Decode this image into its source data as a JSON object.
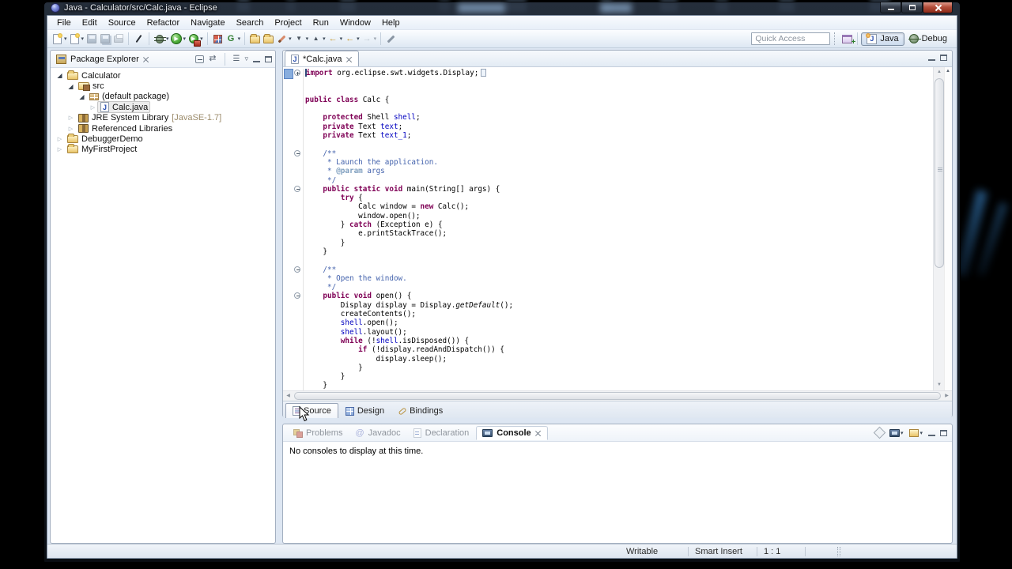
{
  "window": {
    "title": "Java - Calculator/src/Calc.java - Eclipse"
  },
  "menu": {
    "items": [
      "File",
      "Edit",
      "Source",
      "Refactor",
      "Navigate",
      "Search",
      "Project",
      "Run",
      "Window",
      "Help"
    ]
  },
  "toolbar": {
    "quick_access": {
      "placeholder": "Quick Access"
    },
    "perspectives": [
      {
        "label": "Java",
        "active": true
      },
      {
        "label": "Debug",
        "active": false
      }
    ]
  },
  "package_explorer": {
    "title": "Package Explorer",
    "tree": [
      {
        "label": "Calculator",
        "level": 0,
        "state": "expanded",
        "icon": "project"
      },
      {
        "label": "src",
        "level": 1,
        "state": "expanded",
        "icon": "srcfolder"
      },
      {
        "label": "(default package)",
        "level": 2,
        "state": "expanded",
        "icon": "package"
      },
      {
        "label": "Calc.java",
        "level": 3,
        "state": "collapsed",
        "icon": "javafile",
        "selected": true
      },
      {
        "label": "JRE System Library",
        "suffix": "[JavaSE-1.7]",
        "level": 1,
        "state": "collapsed",
        "icon": "library"
      },
      {
        "label": "Referenced Libraries",
        "level": 1,
        "state": "collapsed",
        "icon": "library"
      },
      {
        "label": "DebuggerDemo",
        "level": 0,
        "state": "collapsed",
        "icon": "project"
      },
      {
        "label": "MyFirstProject",
        "level": 0,
        "state": "collapsed",
        "icon": "project"
      }
    ]
  },
  "editor": {
    "tab_label": "*Calc.java",
    "pages": [
      {
        "label": "Source",
        "active": true
      },
      {
        "label": "Design",
        "active": false
      },
      {
        "label": "Bindings",
        "active": false
      }
    ],
    "code": [
      {
        "fold": "+",
        "caret": true,
        "current": true,
        "t": [
          [
            "k",
            "import"
          ],
          [
            "p",
            " org.eclipse.swt.widgets.Display;"
          ],
          [
            "b",
            ""
          ]
        ]
      },
      {
        "t": []
      },
      {
        "t": []
      },
      {
        "t": [
          [
            "k",
            "public"
          ],
          [
            "p",
            " "
          ],
          [
            "k",
            "class"
          ],
          [
            "p",
            " Calc {"
          ]
        ]
      },
      {
        "t": []
      },
      {
        "t": [
          [
            "p",
            "    "
          ],
          [
            "k",
            "protected"
          ],
          [
            "p",
            " Shell "
          ],
          [
            "f",
            "shell"
          ],
          [
            "p",
            ";"
          ]
        ]
      },
      {
        "t": [
          [
            "p",
            "    "
          ],
          [
            "k",
            "private"
          ],
          [
            "p",
            " Text "
          ],
          [
            "f",
            "text"
          ],
          [
            "p",
            ";"
          ]
        ]
      },
      {
        "t": [
          [
            "p",
            "    "
          ],
          [
            "k",
            "private"
          ],
          [
            "p",
            " Text "
          ],
          [
            "f",
            "text_1"
          ],
          [
            "p",
            ";"
          ]
        ]
      },
      {
        "t": []
      },
      {
        "fold": "-",
        "t": [
          [
            "c",
            "    /**"
          ]
        ]
      },
      {
        "t": [
          [
            "c",
            "     * Launch the application."
          ]
        ]
      },
      {
        "t": [
          [
            "c",
            "     * "
          ],
          [
            "t",
            "@param"
          ],
          [
            "c",
            " args"
          ]
        ]
      },
      {
        "t": [
          [
            "c",
            "     */"
          ]
        ]
      },
      {
        "fold": "-",
        "t": [
          [
            "p",
            "    "
          ],
          [
            "k",
            "public"
          ],
          [
            "p",
            " "
          ],
          [
            "k",
            "static"
          ],
          [
            "p",
            " "
          ],
          [
            "k",
            "void"
          ],
          [
            "p",
            " main(String[] args) {"
          ]
        ]
      },
      {
        "t": [
          [
            "p",
            "        "
          ],
          [
            "k",
            "try"
          ],
          [
            "p",
            " {"
          ]
        ]
      },
      {
        "t": [
          [
            "p",
            "            Calc window = "
          ],
          [
            "k",
            "new"
          ],
          [
            "p",
            " Calc();"
          ]
        ]
      },
      {
        "t": [
          [
            "p",
            "            window.open();"
          ]
        ]
      },
      {
        "t": [
          [
            "p",
            "        } "
          ],
          [
            "k",
            "catch"
          ],
          [
            "p",
            " (Exception e) {"
          ]
        ]
      },
      {
        "t": [
          [
            "p",
            "            e.printStackTrace();"
          ]
        ]
      },
      {
        "t": [
          [
            "p",
            "        }"
          ]
        ]
      },
      {
        "t": [
          [
            "p",
            "    }"
          ]
        ]
      },
      {
        "t": []
      },
      {
        "fold": "-",
        "t": [
          [
            "c",
            "    /**"
          ]
        ]
      },
      {
        "t": [
          [
            "c",
            "     * Open the window."
          ]
        ]
      },
      {
        "t": [
          [
            "c",
            "     */"
          ]
        ]
      },
      {
        "fold": "-",
        "t": [
          [
            "p",
            "    "
          ],
          [
            "k",
            "public"
          ],
          [
            "p",
            " "
          ],
          [
            "k",
            "void"
          ],
          [
            "p",
            " open() {"
          ]
        ]
      },
      {
        "t": [
          [
            "p",
            "        Display display = Display."
          ],
          [
            "i",
            "getDefault"
          ],
          [
            "p",
            "();"
          ]
        ]
      },
      {
        "t": [
          [
            "p",
            "        createContents();"
          ]
        ]
      },
      {
        "t": [
          [
            "p",
            "        "
          ],
          [
            "f",
            "shell"
          ],
          [
            "p",
            ".open();"
          ]
        ]
      },
      {
        "t": [
          [
            "p",
            "        "
          ],
          [
            "f",
            "shell"
          ],
          [
            "p",
            ".layout();"
          ]
        ]
      },
      {
        "t": [
          [
            "p",
            "        "
          ],
          [
            "k",
            "while"
          ],
          [
            "p",
            " (!"
          ],
          [
            "f",
            "shell"
          ],
          [
            "p",
            ".isDisposed()) {"
          ]
        ]
      },
      {
        "t": [
          [
            "p",
            "            "
          ],
          [
            "k",
            "if"
          ],
          [
            "p",
            " (!display.readAndDispatch()) {"
          ]
        ]
      },
      {
        "t": [
          [
            "p",
            "                display.sleep();"
          ]
        ]
      },
      {
        "t": [
          [
            "p",
            "            }"
          ]
        ]
      },
      {
        "t": [
          [
            "p",
            "        }"
          ]
        ]
      },
      {
        "t": [
          [
            "p",
            "    }"
          ]
        ]
      }
    ]
  },
  "console_panel": {
    "tabs": [
      {
        "label": "Problems",
        "active": false
      },
      {
        "label": "Javadoc",
        "active": false
      },
      {
        "label": "Declaration",
        "active": false
      },
      {
        "label": "Console",
        "active": true
      }
    ],
    "message": "No consoles to display at this time."
  },
  "status_bar": {
    "items": [
      "Writable",
      "Smart Insert",
      "1 : 1"
    ]
  },
  "colors": {
    "keyword": "#7f0055",
    "javadoc": "#4362ac",
    "javadoc_tag": "#7f9fbf",
    "field": "#0000c0",
    "run_green": "#51b13e",
    "close_red": "#b4503c"
  }
}
